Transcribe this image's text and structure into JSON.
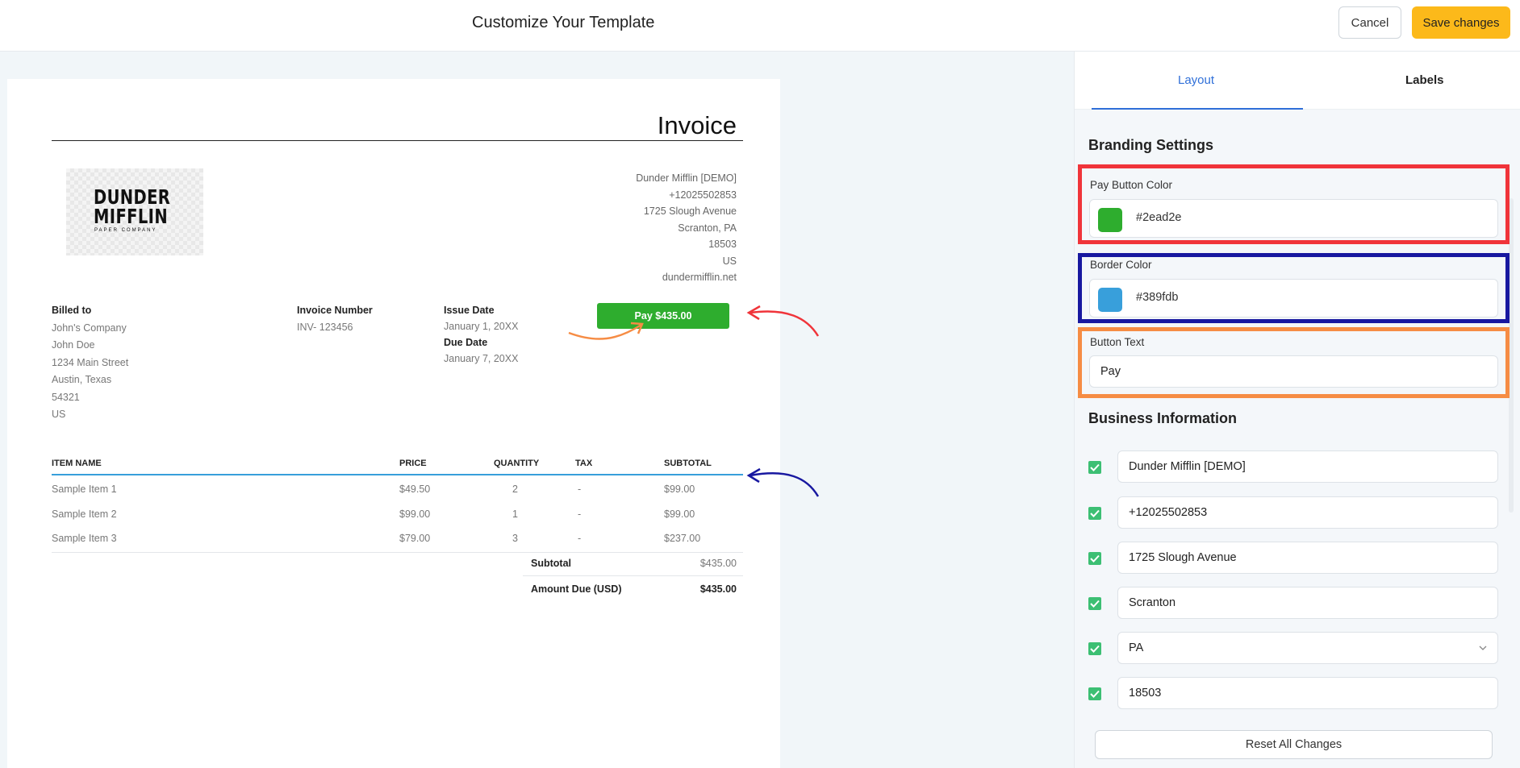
{
  "header": {
    "title": "Customize Your Template",
    "cancel_label": "Cancel",
    "save_label": "Save changes"
  },
  "invoice": {
    "title": "Invoice",
    "logo": {
      "line1": "DUNDER",
      "line2": "MIFFLIN",
      "line3": "PAPER COMPANY"
    },
    "business_address": [
      "Dunder Mifflin [DEMO]",
      "+12025502853",
      "1725 Slough Avenue",
      "Scranton, PA",
      "18503",
      "US",
      "dundermifflin.net"
    ],
    "billed_to": {
      "label": "Billed to",
      "lines": [
        "John's Company",
        "John Doe",
        "1234 Main Street",
        "Austin, Texas",
        "54321",
        "US"
      ]
    },
    "invoice_number": {
      "label": "Invoice Number",
      "value": "INV- 123456"
    },
    "issue_date": {
      "label": "Issue Date",
      "value": "January 1, 20XX"
    },
    "due_date": {
      "label": "Due Date",
      "value": "January 7, 20XX"
    },
    "pay_button_label": "Pay $435.00",
    "pay_button_color": "#2ead2e",
    "border_color": "#389fdb",
    "table": {
      "headers": [
        "ITEM NAME",
        "PRICE",
        "QUANTITY",
        "TAX",
        "SUBTOTAL"
      ],
      "rows": [
        [
          "Sample Item 1",
          "$49.50",
          "2",
          "-",
          "$99.00"
        ],
        [
          "Sample Item 2",
          "$99.00",
          "1",
          "-",
          "$99.00"
        ],
        [
          "Sample Item 3",
          "$79.00",
          "3",
          "-",
          "$237.00"
        ]
      ]
    },
    "totals": {
      "subtotal_label": "Subtotal",
      "subtotal_value": "$435.00",
      "amount_due_label": "Amount Due (USD)",
      "amount_due_value": "$435.00"
    }
  },
  "annotations": {
    "red_color": "#f0343a",
    "blue_color": "#1818a0",
    "orange_color": "#f68c44"
  },
  "panel": {
    "tabs": [
      "Layout",
      "Labels"
    ],
    "active_tab": "Layout",
    "branding": {
      "title": "Branding Settings",
      "pay_button_color_label": "Pay Button Color",
      "pay_button_color_value": "#2ead2e",
      "border_color_label": "Border Color",
      "border_color_value": "#389fdb",
      "button_text_label": "Button Text",
      "button_text_value": "Pay"
    },
    "business_info": {
      "title": "Business Information",
      "fields": [
        {
          "value": "Dunder Mifflin [DEMO]",
          "checked": true
        },
        {
          "value": "+12025502853",
          "checked": true
        },
        {
          "value": "1725 Slough Avenue",
          "checked": true
        },
        {
          "value": "Scranton",
          "checked": true
        },
        {
          "value": "PA",
          "checked": true,
          "type": "select"
        },
        {
          "value": "18503",
          "checked": true
        }
      ]
    },
    "reset_label": "Reset All Changes"
  }
}
